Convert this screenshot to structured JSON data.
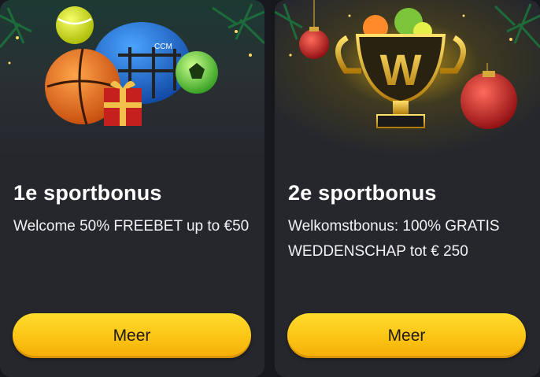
{
  "cards": [
    {
      "title": "1e sportbonus",
      "description": "Welcome 50% FREEBET up to €50",
      "button_label": "Meer",
      "image": "sports-balls-helmet-christmas-illustration"
    },
    {
      "title": "2e sportbonus",
      "description": "Welkomstbonus: 100% GRATIS WEDDENSCHAP tot € 250",
      "button_label": "Meer",
      "image": "golden-trophy-w-christmas-illustration"
    }
  ],
  "colors": {
    "card_background": "#25272d",
    "page_background": "#17181c",
    "button_yellow": "#fbc414",
    "title_text": "#ffffff"
  }
}
